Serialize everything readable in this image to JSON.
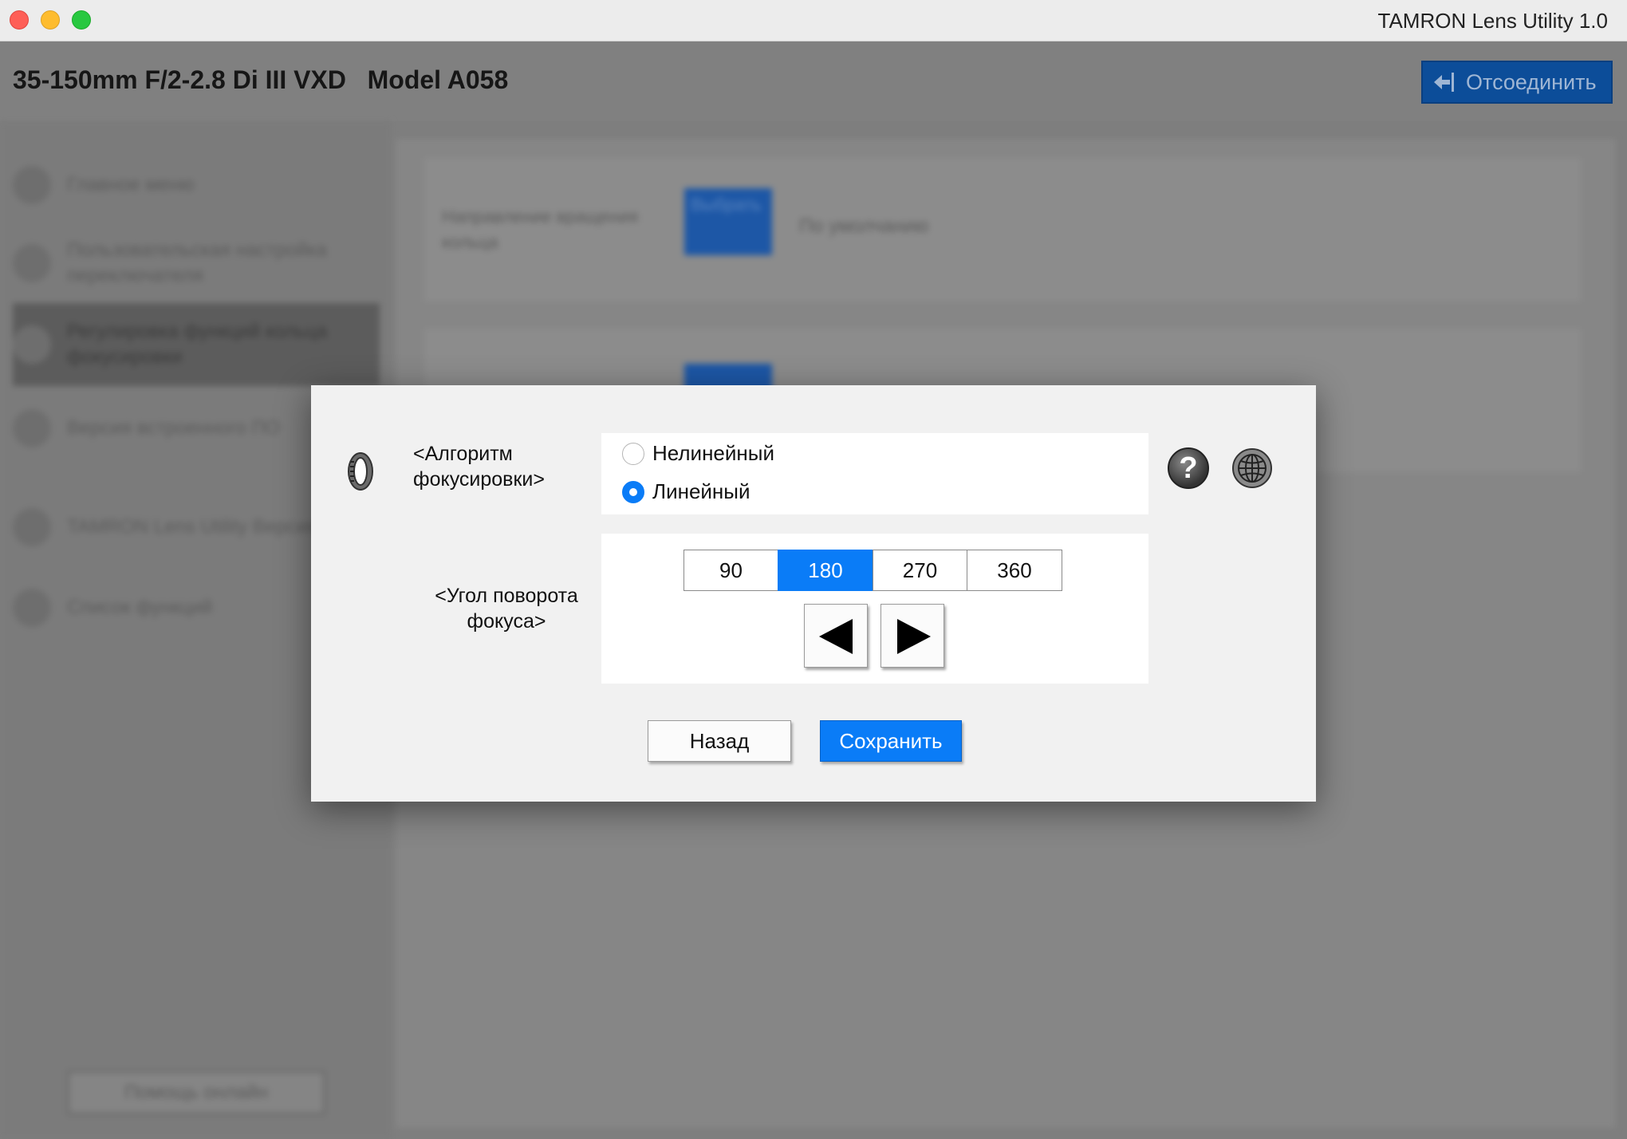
{
  "window": {
    "title": "TAMRON Lens Utility  1.0"
  },
  "header": {
    "lens_name": "35-150mm F/2-2.8 Di III VXD   Model A058",
    "disconnect_label": "Отсоединить"
  },
  "sidebar": {
    "items": [
      {
        "label": "Главное меню",
        "icon": "home-icon"
      },
      {
        "label": "Пользовательская настройка переключателя",
        "icon": "switch-icon"
      },
      {
        "label": "Регулировка функций кольца фокусировки",
        "icon": "focus-ring-icon"
      },
      {
        "label": "Версия встроенного ПО",
        "icon": "firmware-icon"
      },
      {
        "label": "TAMRON Lens Utility Версия ПО",
        "icon": "info-icon"
      },
      {
        "label": "Список функций",
        "icon": "list-icon"
      }
    ],
    "help_label": "Помощь онлайн"
  },
  "background_cards": [
    {
      "label": "Направление вращения кольца",
      "button": "Выбрать",
      "value": "По умолчанию"
    },
    {
      "label": "",
      "button": "",
      "value": ""
    }
  ],
  "dialog": {
    "algo_label": "<Алгоритм фокусировки>",
    "algo_options": [
      "Нелинейный",
      "Линейный"
    ],
    "algo_selected": "Линейный",
    "angle_label": "<Угол поворота фокуса>",
    "angle_options": [
      "90",
      "180",
      "270",
      "360"
    ],
    "angle_selected": "180",
    "back_label": "Назад",
    "save_label": "Сохранить",
    "icons": [
      "focus-ring-icon",
      "help-icon",
      "globe-icon",
      "left-arrow-icon",
      "right-arrow-icon"
    ],
    "colors": {
      "accent": "#0a7cf7",
      "dialog_bg": "#f1f1f1"
    }
  }
}
